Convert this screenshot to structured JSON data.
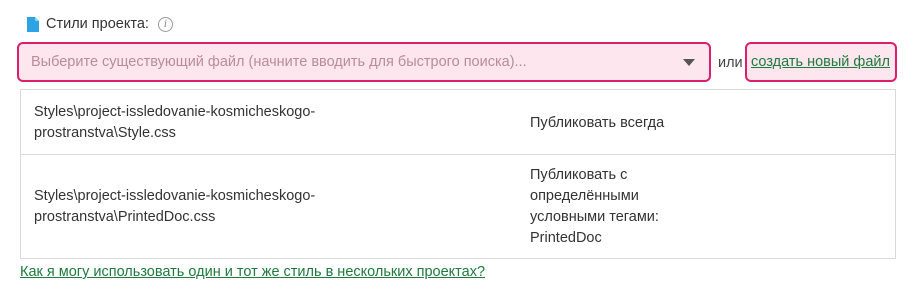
{
  "styles_label": {
    "text": "Стили проекта:",
    "icon": "file-icon",
    "info_icon_glyph": "i"
  },
  "select": {
    "placeholder": "Выберите существующий файл (начните вводить для быстрого поиска)..."
  },
  "or_text": "или",
  "create_link": "создать новый файл",
  "table": {
    "rows": [
      {
        "path_line1": "Styles\\project-issledovanie-kosmicheskogo-",
        "path_line2": "prostranstva\\Style.css",
        "publish": [
          "Публиковать всегда"
        ]
      },
      {
        "path_line1": "Styles\\project-issledovanie-kosmicheskogo-",
        "path_line2": "prostranstva\\PrintedDoc.css",
        "publish": [
          "Публиковать с",
          "определёнными",
          "условными тегами:",
          "PrintedDoc"
        ]
      }
    ]
  },
  "help_link": "Как я могу использовать один и тот же стиль в нескольких проектах?",
  "colors": {
    "accent_border": "#dd1e6c",
    "highlight_bg": "#fde6ee",
    "link": "#1f7a3d",
    "file_icon": "#2ea3e3"
  }
}
